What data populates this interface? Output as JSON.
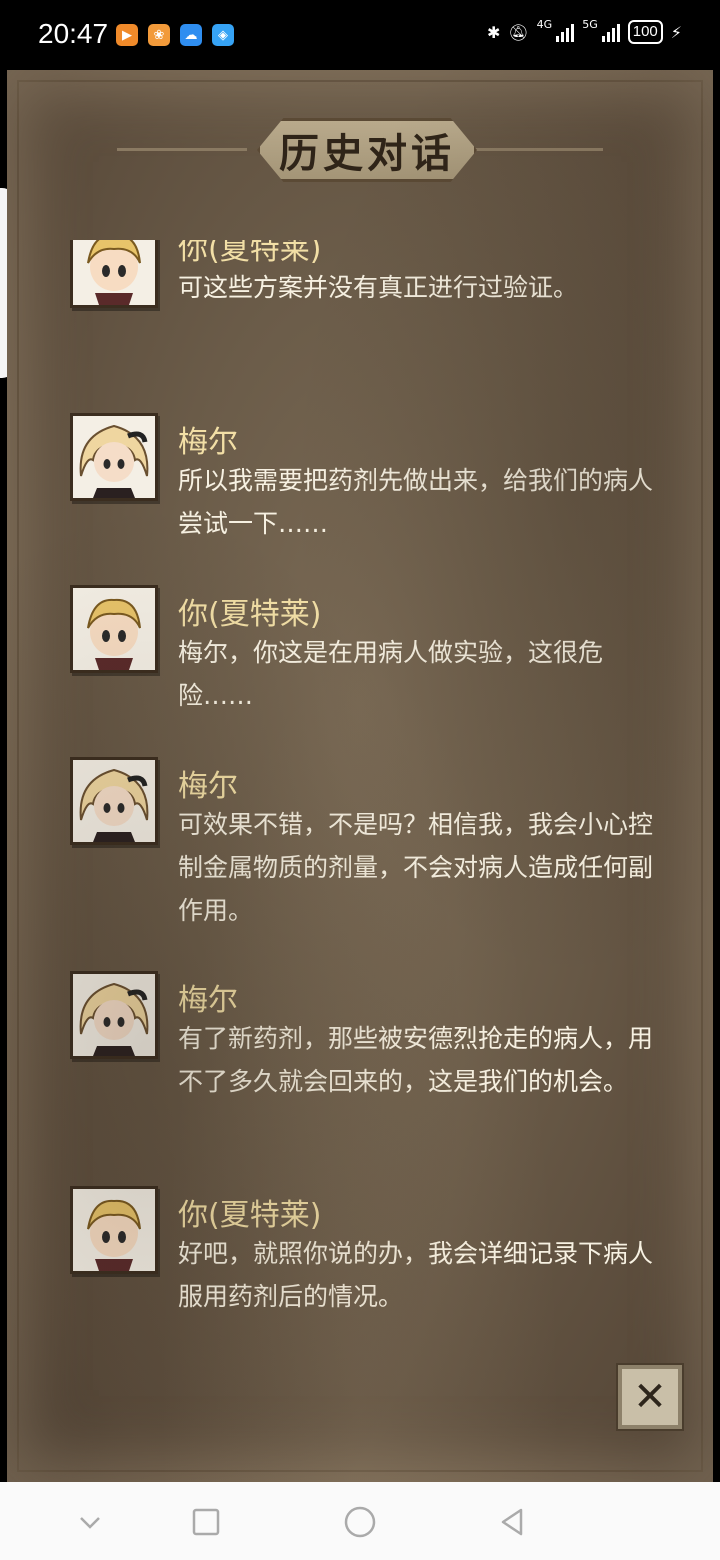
{
  "status_bar": {
    "time": "20:47",
    "network_4g": "4G",
    "network_5g": "5G",
    "battery": "100"
  },
  "panel": {
    "title": "历史对话",
    "close_label": "✕"
  },
  "dialog": [
    {
      "speaker": "你(夏特莱)",
      "text": "可这些方案并没有真正进行过验证。",
      "avatar": "chatelet-portrait"
    },
    {
      "speaker": "梅尔",
      "text": "所以我需要把药剂先做出来，给我们的病人尝试一下……",
      "avatar": "mel-portrait"
    },
    {
      "speaker": "你(夏特莱)",
      "text": "梅尔，你这是在用病人做实验，这很危险……",
      "avatar": "chatelet-portrait"
    },
    {
      "speaker": "梅尔",
      "text": "可效果不错，不是吗？相信我，我会小心控制金属物质的剂量，不会对病人造成任何副作用。",
      "avatar": "mel-portrait"
    },
    {
      "speaker": "梅尔",
      "text": "有了新药剂，那些被安德烈抢走的病人，用不了多久就会回来的，这是我们的机会。",
      "avatar": "mel-portrait"
    },
    {
      "speaker": "你(夏特莱)",
      "text": "好吧，就照你说的办，我会详细记录下病人服用药剂后的情况。",
      "avatar": "chatelet-portrait"
    }
  ],
  "colors": {
    "speaker": "#f2dfa6",
    "text": "#f7f1e2",
    "panel": "#6b5c49"
  }
}
